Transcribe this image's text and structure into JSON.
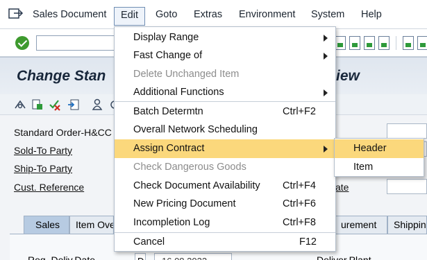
{
  "menubar": {
    "items": [
      "Sales Document",
      "Edit",
      "Goto",
      "Extras",
      "Environment",
      "System",
      "Help"
    ]
  },
  "title": {
    "left": "Change Stan",
    "right": "iew"
  },
  "form": {
    "order_type": "Standard Order-H&CC",
    "sold_to": "Sold-To Party",
    "ship_to": "Ship-To Party",
    "cust_ref": "Cust. Reference",
    "ref_date_fragment": "ate"
  },
  "tabs": [
    "Sales",
    "Item Ove",
    "urement",
    "Shipping"
  ],
  "tab_content": {
    "req_deliv_date": "Req. Deliv.Date",
    "date_format": "D",
    "date_value": "16.08.2022",
    "deliver_plant": "Deliver.Plant"
  },
  "edit_menu": {
    "items": [
      {
        "label": "Display Range",
        "accel": "",
        "submenu": true,
        "disabled": false
      },
      {
        "label": "Fast Change of",
        "accel": "",
        "submenu": true,
        "disabled": false
      },
      {
        "label": "Delete Unchanged Item",
        "accel": "",
        "submenu": false,
        "disabled": true
      },
      {
        "label": "Additional Functions",
        "accel": "",
        "submenu": true,
        "disabled": false
      },
      {
        "label": "Batch Determtn",
        "accel": "Ctrl+F2",
        "submenu": false,
        "disabled": false
      },
      {
        "label": "Overall Network Scheduling",
        "accel": "",
        "submenu": false,
        "disabled": false
      },
      {
        "label": "Assign Contract",
        "accel": "",
        "submenu": true,
        "disabled": false,
        "highlighted": true
      },
      {
        "label": "Check Dangerous Goods",
        "accel": "",
        "submenu": false,
        "disabled": true
      },
      {
        "label": "Check Document Availability",
        "accel": "Ctrl+F4",
        "submenu": false,
        "disabled": false
      },
      {
        "label": "New Pricing Document",
        "accel": "Ctrl+F6",
        "submenu": false,
        "disabled": false
      },
      {
        "label": "Incompletion Log",
        "accel": "Ctrl+F8",
        "submenu": false,
        "disabled": false
      },
      {
        "label": "Cancel",
        "accel": "F12",
        "submenu": false,
        "disabled": false
      }
    ]
  },
  "assign_contract_submenu": {
    "items": [
      "Header",
      "Item"
    ]
  },
  "colors": {
    "highlight": "#fbd87c",
    "menu_border": "#b4bfcc",
    "ok_green": "#3e9a2e",
    "title_text": "#18273b"
  }
}
